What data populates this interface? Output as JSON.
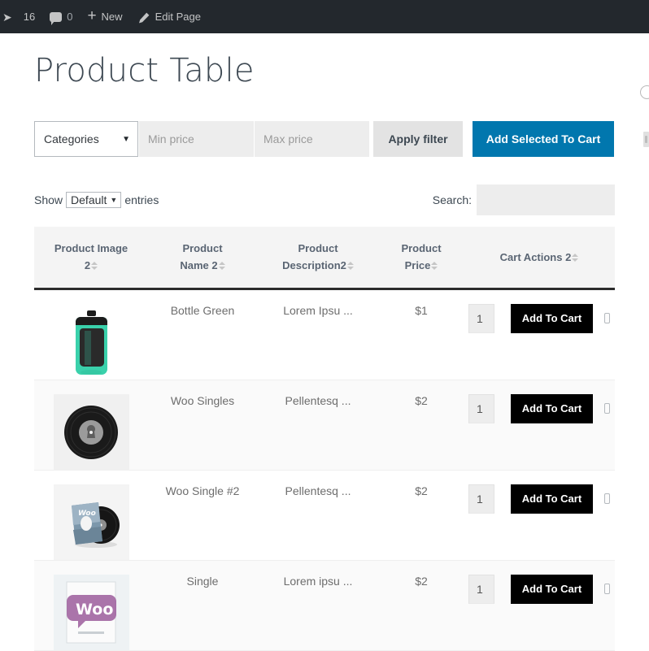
{
  "adminbar": {
    "items": [
      {
        "name": "site-updates",
        "icon": "arrow-icon",
        "label": "16"
      },
      {
        "name": "comments",
        "icon": "comment-icon",
        "label": "0"
      },
      {
        "name": "new-content",
        "icon": "plus-icon",
        "label": "New"
      },
      {
        "name": "edit-page",
        "icon": "pencil-icon",
        "label": "Edit Page"
      }
    ]
  },
  "page": {
    "title": "Product Table"
  },
  "filters": {
    "category": {
      "selected": "Categories",
      "caret": "▼"
    },
    "min_price_placeholder": "Min price",
    "max_price_placeholder": "Max price",
    "min_price_value": "",
    "max_price_value": "",
    "apply_filter_label": "Apply filter",
    "add_selected_label": "Add Selected To Cart",
    "accent_color": "#0177ae"
  },
  "controls": {
    "show_label": "Show",
    "entries_label": "entries",
    "length_selected": "Default",
    "length_caret": "▼",
    "search_label": "Search:",
    "search_value": "",
    "search_placeholder": ""
  },
  "table": {
    "columns": [
      {
        "name": "product-image",
        "line1": "Product Image",
        "line2": "2",
        "sortable": true
      },
      {
        "name": "product-name",
        "line1": "Product",
        "line2": "Name 2",
        "sortable": true
      },
      {
        "name": "product-description",
        "line1": "Product",
        "line2": "Description2",
        "sortable": true
      },
      {
        "name": "product-price",
        "line1": "Product",
        "line2": "Price",
        "sortable": true
      },
      {
        "name": "cart-actions",
        "line1": "Cart Actions 2",
        "line2": "",
        "sortable": true
      }
    ],
    "add_to_cart_label": "Add To Cart",
    "rows": [
      {
        "image": "green-water-bottle",
        "image_bg": "#ffffff",
        "name": "Bottle Green",
        "description": "Lorem Ipsu ...",
        "price": "$1",
        "quantity": "1",
        "checked": false
      },
      {
        "image": "vinyl-record",
        "image_bg": "#f0f0f0",
        "name": "Woo Singles",
        "description": "Pellentesq ...",
        "price": "$2",
        "quantity": "1",
        "checked": false
      },
      {
        "image": "vinyl-record-sleeve",
        "image_bg": "#f4f4f4",
        "name": "Woo Single #2",
        "description": "Pellentesq ...",
        "price": "$2",
        "quantity": "1",
        "checked": false
      },
      {
        "image": "woo-logo",
        "image_bg": "#eef2f4",
        "name": "Single",
        "description": "Lorem ipsu ...",
        "price": "$2",
        "quantity": "1",
        "checked": false
      }
    ]
  }
}
